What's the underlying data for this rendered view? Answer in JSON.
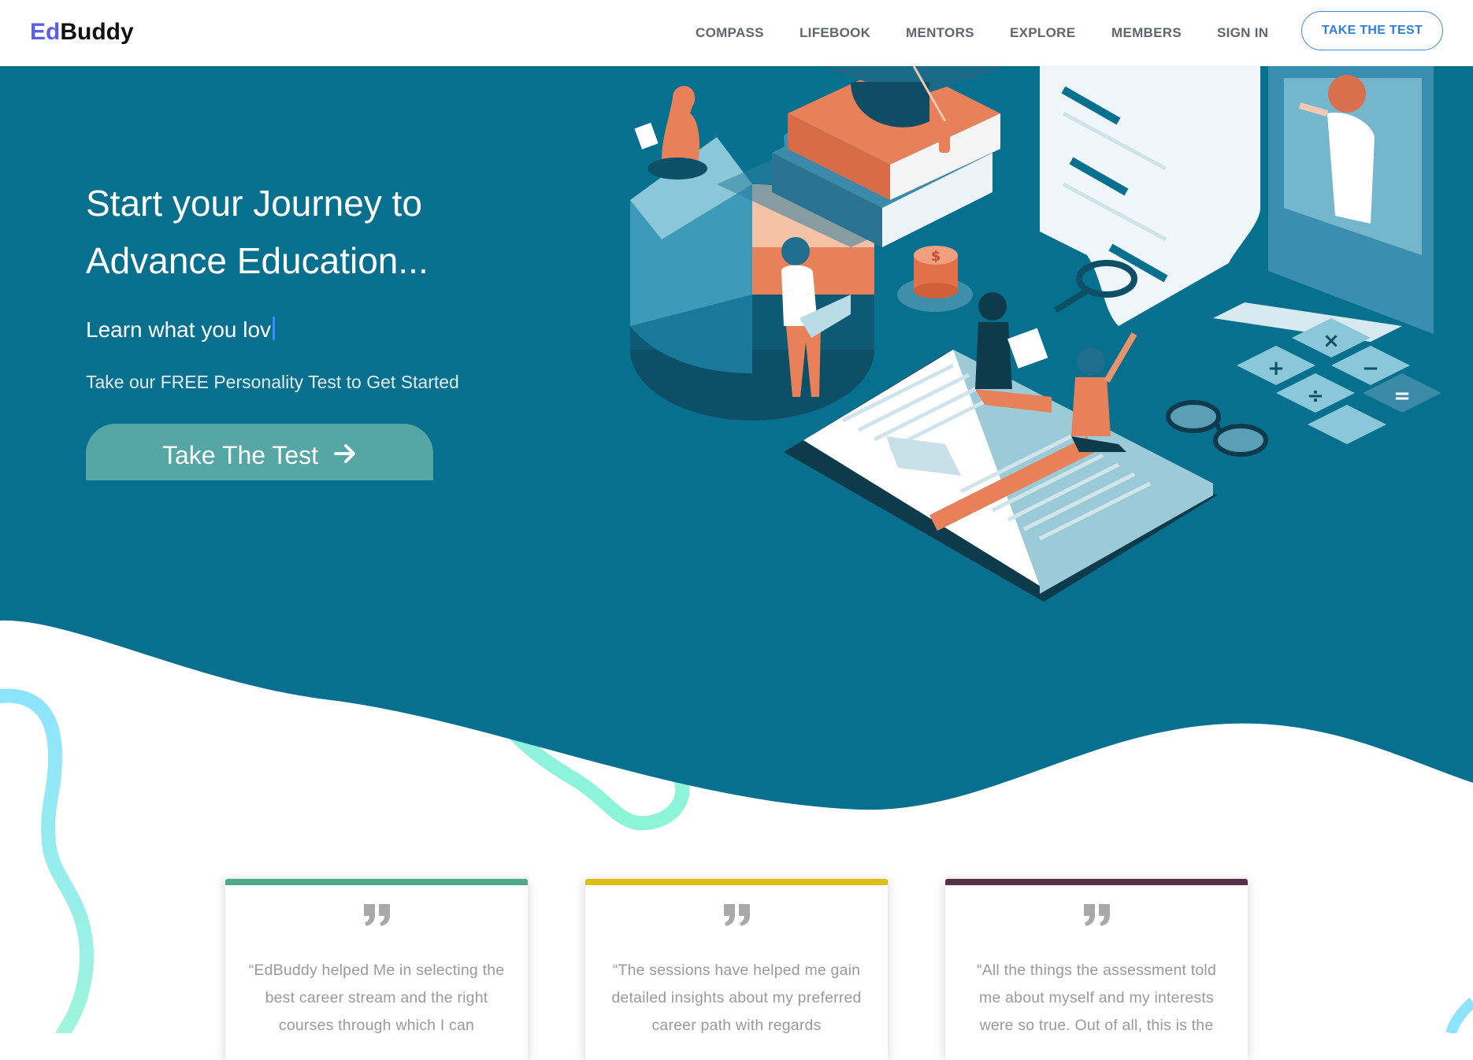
{
  "brand": {
    "prefix": "Ed",
    "suffix": "Buddy",
    "prefix_color": "#5b5fe6"
  },
  "nav": {
    "items": [
      "COMPASS",
      "LIFEBOOK",
      "MENTORS",
      "EXPLORE",
      "MEMBERS",
      "SIGN IN"
    ],
    "cta": "TAKE THE TEST"
  },
  "hero": {
    "title_line1": "Start your Journey to",
    "title_line2": "Advance Education...",
    "typed_text": "Learn what you lov",
    "subtitle": "Take our FREE Personality Test to Get Started",
    "button_label": "Take The Test",
    "button_icon": "arrow-right-icon",
    "background_color": "#07708e",
    "button_color": "#55a6a5"
  },
  "testimonials": [
    {
      "text": "“EdBuddy helped Me in selecting the best career stream and the right courses through which I can",
      "accent": "#4faa88",
      "icon": "quote-icon"
    },
    {
      "text": "“The sessions have helped me gain detailed insights about my preferred career path with regards",
      "accent": "#dcc016",
      "icon": "quote-icon"
    },
    {
      "text": "“All the things the assessment told me about myself and my interests were so true. Out of all, this is the",
      "accent": "#5a3048",
      "icon": "quote-icon"
    }
  ]
}
